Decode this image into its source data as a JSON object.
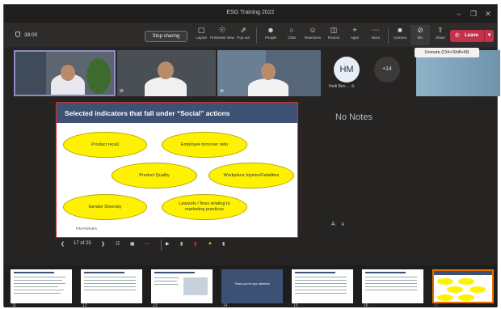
{
  "window": {
    "title": "ESG Training 2022",
    "controls": [
      "minimize-icon",
      "maximize-icon",
      "close-icon"
    ]
  },
  "toolbar": {
    "timer": "38:00",
    "stop_sharing": "Stop sharing",
    "buttons": [
      {
        "label": "Layout",
        "icon": "layout-icon"
      },
      {
        "label": "Presenter view",
        "icon": "presenter-view-icon"
      },
      {
        "label": "Pop out",
        "icon": "pop-out-icon"
      },
      {
        "label": "People",
        "icon": "people-icon"
      },
      {
        "label": "Chat",
        "icon": "chat-icon"
      },
      {
        "label": "Reactions",
        "icon": "reactions-icon"
      },
      {
        "label": "Rooms",
        "icon": "rooms-icon"
      },
      {
        "label": "Apps",
        "icon": "apps-icon"
      },
      {
        "label": "More",
        "icon": "more-icon"
      },
      {
        "label": "Camera",
        "icon": "camera-icon"
      },
      {
        "label": "Mic",
        "icon": "mic-off-icon"
      },
      {
        "label": "Share",
        "icon": "share-icon"
      }
    ],
    "leave": "Leave",
    "tooltip": "Unmute (Ctrl+Shift+M)"
  },
  "participants": {
    "avatar_initials": "HM",
    "avatar_name": "Hedi Ben ...",
    "overflow_count": "+14"
  },
  "slide": {
    "title": "Selected indicators that fall under “Social” actions",
    "items": [
      "Product recall",
      "Employee turnover ratio",
      "Product Quality",
      "Workplace Injuries/Fatalities",
      "Gender Diversity",
      "Lawsuits / fines relating to marketing practices"
    ],
    "footer": "FIM Partners"
  },
  "notes": {
    "empty_text": "No Notes",
    "font_smaller": "A",
    "font_larger": "A"
  },
  "slide_nav": {
    "counter": "17 of 25"
  },
  "thumbnails": [
    "11",
    "12",
    "13",
    "14",
    "15",
    "16",
    "17"
  ],
  "thumb_14_text": "Thank you for your attention",
  "colors": {
    "leave": "#c4314b",
    "slide_header": "#3d5174",
    "ellipse": "#fef200",
    "selected_thumb": "#e87400"
  }
}
